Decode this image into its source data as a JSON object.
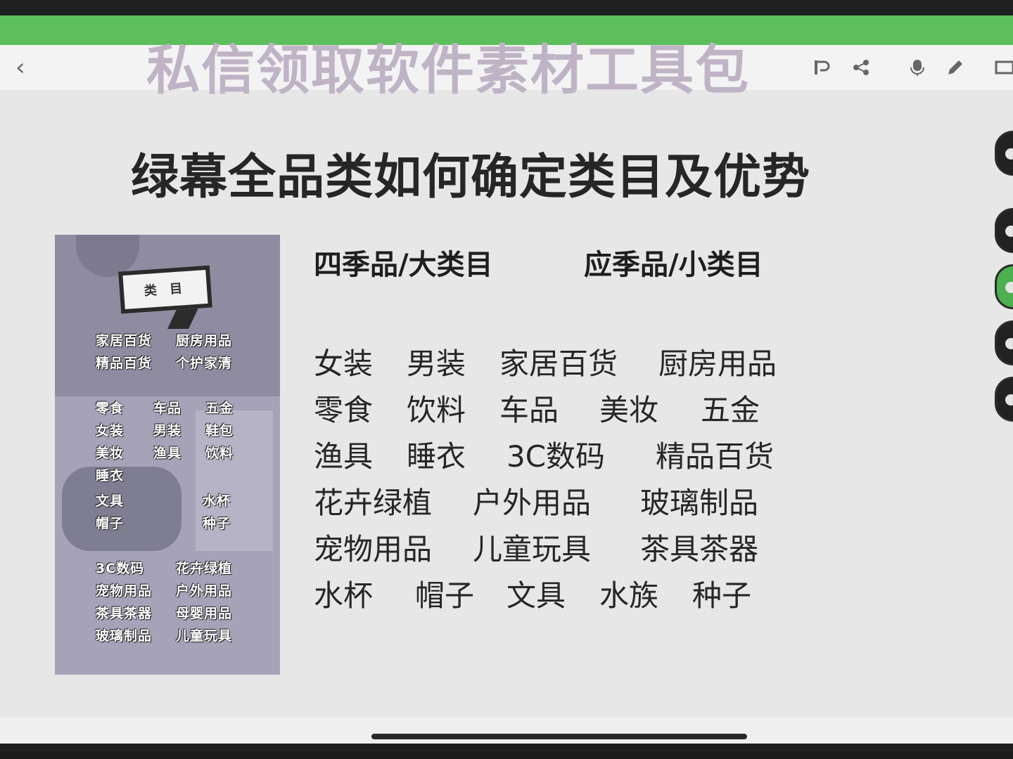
{
  "watermark": "私信领取软件素材工具包",
  "back_icon": "‹",
  "toolbar_icons": [
    "rotate-icon",
    "share-icon",
    "microphone-icon",
    "pen-icon",
    "window-icon"
  ],
  "slide": {
    "title": "绿幕全品类如何确定类目及优势",
    "col_heading_1": "四季品/大类目",
    "col_heading_2": "应季品/小类目",
    "rows": [
      [
        "女装",
        "男装",
        "家居百货",
        "厨房用品"
      ],
      [
        "零食",
        "饮料",
        "车品",
        "美妆",
        "五金"
      ],
      [
        "渔具",
        "睡衣",
        "3C数码",
        "精品百货"
      ],
      [
        "花卉绿植",
        "户外用品",
        "玻璃制品"
      ],
      [
        "宠物用品",
        "儿童玩具",
        "茶具茶器"
      ],
      [
        "水杯",
        "帽子",
        "文具",
        "水族",
        "种子"
      ]
    ]
  },
  "poster": {
    "label": "类 目",
    "items": [
      "家居百货",
      "厨房用品",
      "精品百货",
      "个护家清",
      "零食",
      "车品",
      "五金",
      "女装",
      "男装",
      "鞋包",
      "美妆",
      "渔具",
      "饮料",
      "睡衣",
      "文具",
      "水杯",
      "帽子",
      "种子",
      "3C数码",
      "花卉绿植",
      "宠物用品",
      "户外用品",
      "茶具茶器",
      "母婴用品",
      "玻璃制品",
      "儿童玩具"
    ]
  },
  "colors": {
    "accent_green": "#5cbf5c",
    "side_active": "#4caf50"
  }
}
